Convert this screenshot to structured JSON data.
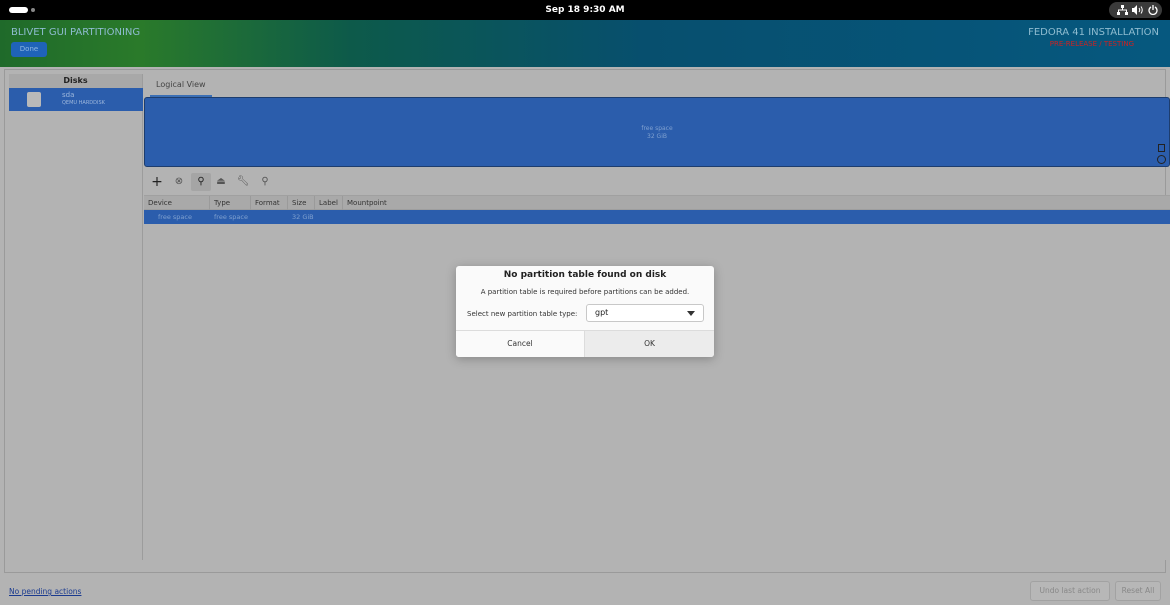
{
  "topbar": {
    "clock": "Sep 18   9:30 AM"
  },
  "header": {
    "app_title": "BLIVET GUI PARTITIONING",
    "done_label": "Done",
    "install_title": "FEDORA 41 INSTALLATION",
    "prerelease": "PRE-RELEASE / TESTING"
  },
  "disks": {
    "header": "Disks",
    "items": [
      {
        "name": "sda",
        "model": "QEMU HARDDISK"
      }
    ]
  },
  "main": {
    "tab": "Logical View",
    "visual": {
      "label": "free space",
      "size": "32 GiB"
    },
    "columns": [
      "Device",
      "Type",
      "Format",
      "Size",
      "Label",
      "Mountpoint"
    ],
    "rows": [
      {
        "device": "free space",
        "type": "free space",
        "format": "",
        "size": "32 GiB",
        "label": "",
        "mountpoint": ""
      }
    ]
  },
  "bottom": {
    "pending": "No pending actions",
    "undo": "Undo last action",
    "reset": "Reset All"
  },
  "dialog": {
    "title": "No partition table found on disk",
    "message": "A partition table is required before partitions can be added.",
    "select_label": "Select new partition table type:",
    "select_value": "gpt",
    "cancel": "Cancel",
    "ok": "OK"
  },
  "icons": [
    "network-icon",
    "volume-icon",
    "power-icon",
    "add-icon",
    "delete-icon",
    "edit-icon",
    "unmount-icon",
    "settings-icon",
    "info-icon"
  ]
}
